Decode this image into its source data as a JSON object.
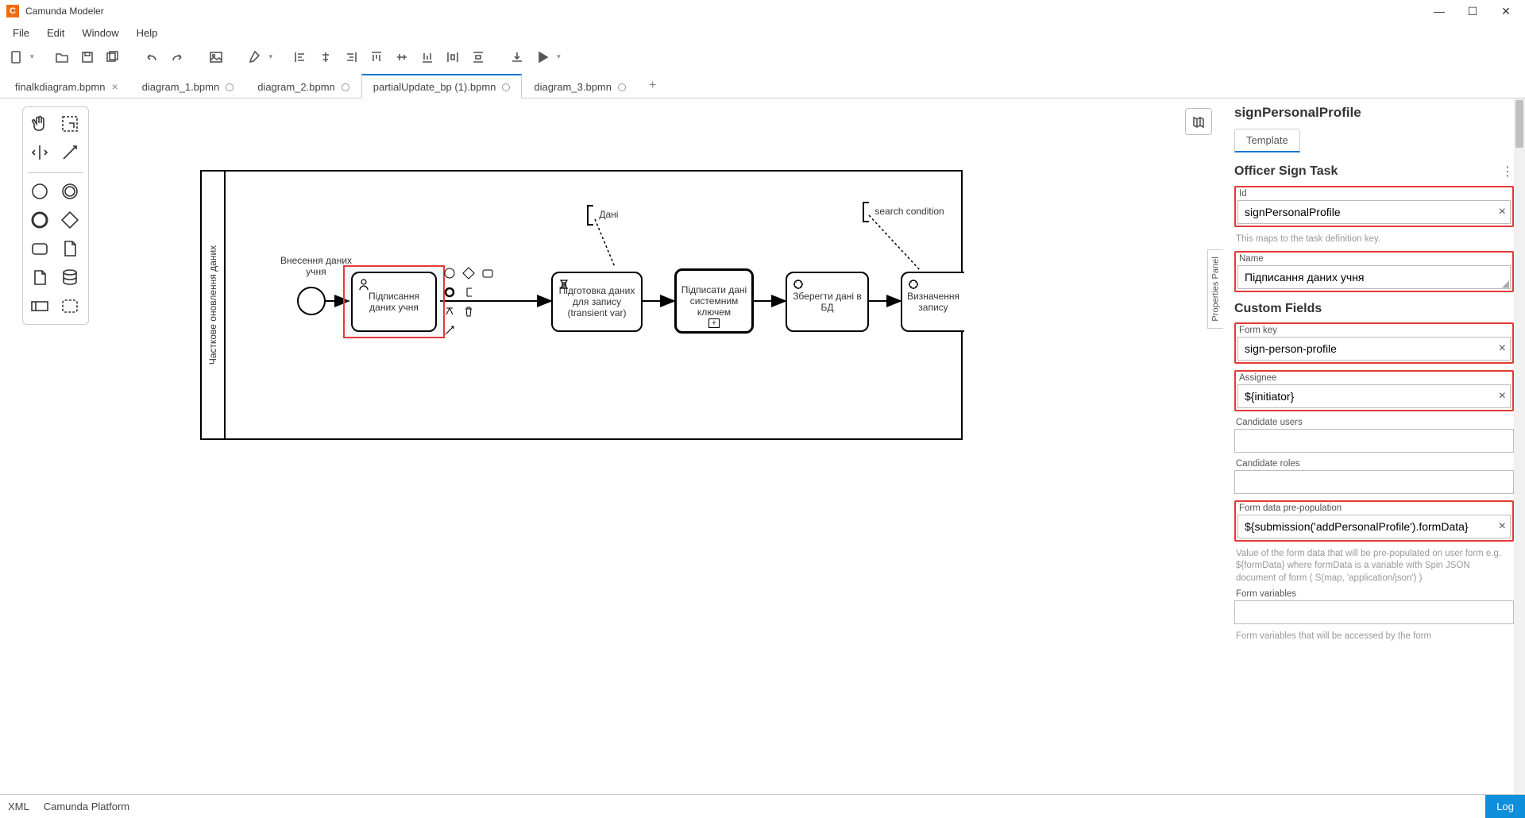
{
  "app": {
    "title": "Camunda Modeler"
  },
  "menu": {
    "file": "File",
    "edit": "Edit",
    "window": "Window",
    "help": "Help"
  },
  "tabs": [
    {
      "label": "finalkdiagram.bpmn",
      "close": true
    },
    {
      "label": "diagram_1.bpmn",
      "dirty": true
    },
    {
      "label": "diagram_2.bpmn",
      "dirty": true
    },
    {
      "label": "partialUpdate_bp (1).bpmn",
      "dirty": true,
      "active": true
    },
    {
      "label": "diagram_3.bpmn",
      "dirty": true
    }
  ],
  "diagram": {
    "lane_label": "Часткове оновлення даних",
    "start_label": "Внесення даних учня",
    "task_selected": "Підписання даних учня",
    "task_prepare": "Підготовка даних для запису (transient var)",
    "task_system_sign": "Підписати дані системним ключем",
    "task_save_db": "Зберегти дані в БД",
    "task_define": "Визначення запису",
    "annot_data": "Дані",
    "annot_search": "search condition",
    "panel_tab": "Properties Panel"
  },
  "properties": {
    "title": "signPersonalProfile",
    "subtab": "Template",
    "section1": "Officer Sign Task",
    "id_label": "Id",
    "id_value": "signPersonalProfile",
    "id_hint": "This maps to the task definition key.",
    "name_label": "Name",
    "name_value": "Підписання даних учня",
    "section2": "Custom Fields",
    "formkey_label": "Form key",
    "formkey_value": "sign-person-profile",
    "assignee_label": "Assignee",
    "assignee_value": "${initiator}",
    "cand_users_label": "Candidate users",
    "cand_users_value": "",
    "cand_roles_label": "Candidate roles",
    "cand_roles_value": "",
    "prepop_label": "Form data pre-population",
    "prepop_value": "${submission('addPersonalProfile').formData}",
    "prepop_hint": "Value of the form data that will be pre-populated on user form e.g. ${formData} where formData is a variable with Spin JSON document of form ( S(map, 'application/json') )",
    "formvars_label": "Form variables",
    "formvars_value": "",
    "formvars_hint": "Form variables that will be accessed by the form"
  },
  "statusbar": {
    "xml": "XML",
    "platform": "Camunda Platform",
    "log": "Log"
  }
}
